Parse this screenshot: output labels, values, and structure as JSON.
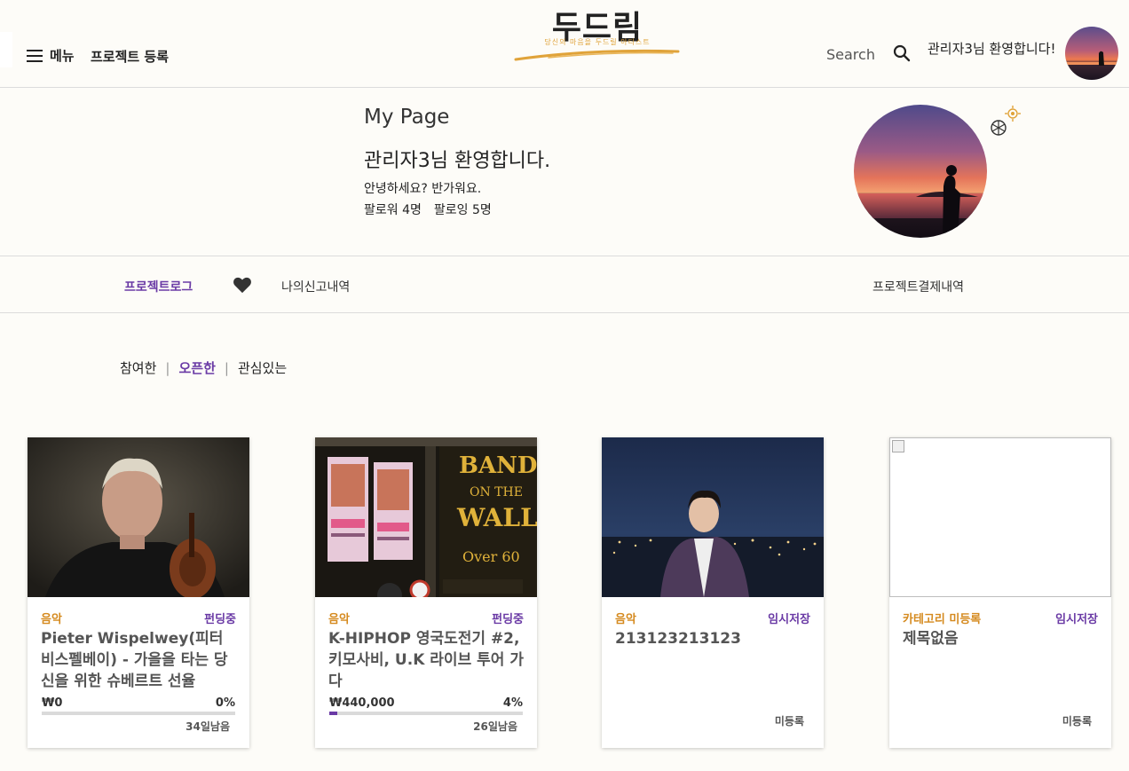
{
  "header": {
    "menu_label": "메뉴",
    "register_label": "프로젝트 등록",
    "logo_title": "두드림",
    "logo_subtitle": "당신의 마음을 두드릴 아티스트",
    "search_label": "Search",
    "welcome": "관리자3님 환영합니다!",
    "menu_icon": "hamburger-icon",
    "search_icon": "magnifier-icon"
  },
  "profile": {
    "page_title": "My Page",
    "welcome": "관리자3님 환영합니다.",
    "greeting": "안녕하세요? 반가워요.",
    "followers": "팔로워 4명",
    "following": "팔로잉 5명",
    "settings_icon": "gear-icon"
  },
  "tabs": {
    "project_log": "프로젝트로그",
    "heart_icon": "heart-icon",
    "my_reports": "나의신고내역",
    "payments": "프로젝트결제내역"
  },
  "filters": {
    "participated": "참여한",
    "opened": "오픈한",
    "interested": "관심있는",
    "active": "opened"
  },
  "projects": [
    {
      "category": "음악",
      "status": "펀딩중",
      "title": "Pieter Wispelwey(피터 비스펠베이) - 가을을 타는 당신을 위한 슈베르트 선율",
      "amount": "₩0",
      "percent": "0%",
      "progress": 0,
      "days_left": "34일남음"
    },
    {
      "category": "음악",
      "status": "펀딩중",
      "title": "K-HIPHOP 영국도전기 #2, 키모사비, U.K 라이브 투어 가다",
      "amount": "₩440,000",
      "percent": "4%",
      "progress": 4,
      "days_left": "26일남음"
    },
    {
      "category": "음악",
      "status": "임시저장",
      "title": "213123213123",
      "unregistered": "미등록"
    },
    {
      "category": "카테고리 미등록",
      "status": "임시저장",
      "title": "제목없음",
      "unregistered": "미등록"
    }
  ],
  "colors": {
    "accent_purple": "#6a3aa5",
    "category_orange": "#d58a1f",
    "logo_gold": "#e0a33a",
    "background": "#fdfcf8"
  }
}
